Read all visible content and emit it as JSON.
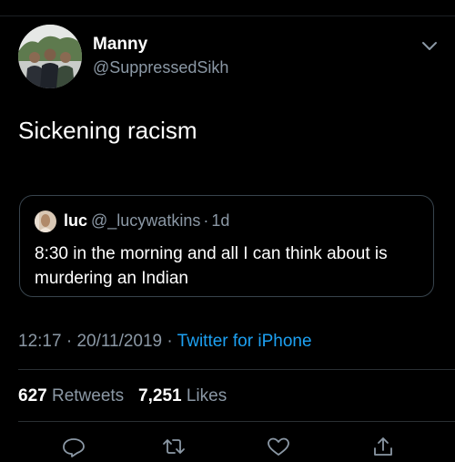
{
  "tweet": {
    "author": {
      "display_name": "Manny",
      "handle": "@SuppressedSikh"
    },
    "text": "Sickening racism",
    "quoted": {
      "author_name": "luc",
      "author_handle": "@_lucywatkins",
      "separator": "·",
      "time_ago": "1d",
      "text": "8:30 in the morning and all I can think about is murdering an Indian"
    },
    "meta": {
      "time": "12:17",
      "separator": "·",
      "date": "20/11/2019",
      "source": "Twitter for iPhone"
    },
    "stats": {
      "retweets_count": "627",
      "retweets_label": "Retweets",
      "likes_count": "7,251",
      "likes_label": "Likes"
    },
    "actions": [
      "reply-icon",
      "retweet-icon",
      "like-icon",
      "share-icon"
    ]
  },
  "colors": {
    "background": "#000000",
    "primary_text": "#ffffff",
    "secondary_text": "#8b98a5",
    "link": "#1da1f2",
    "border": "#38444d"
  }
}
